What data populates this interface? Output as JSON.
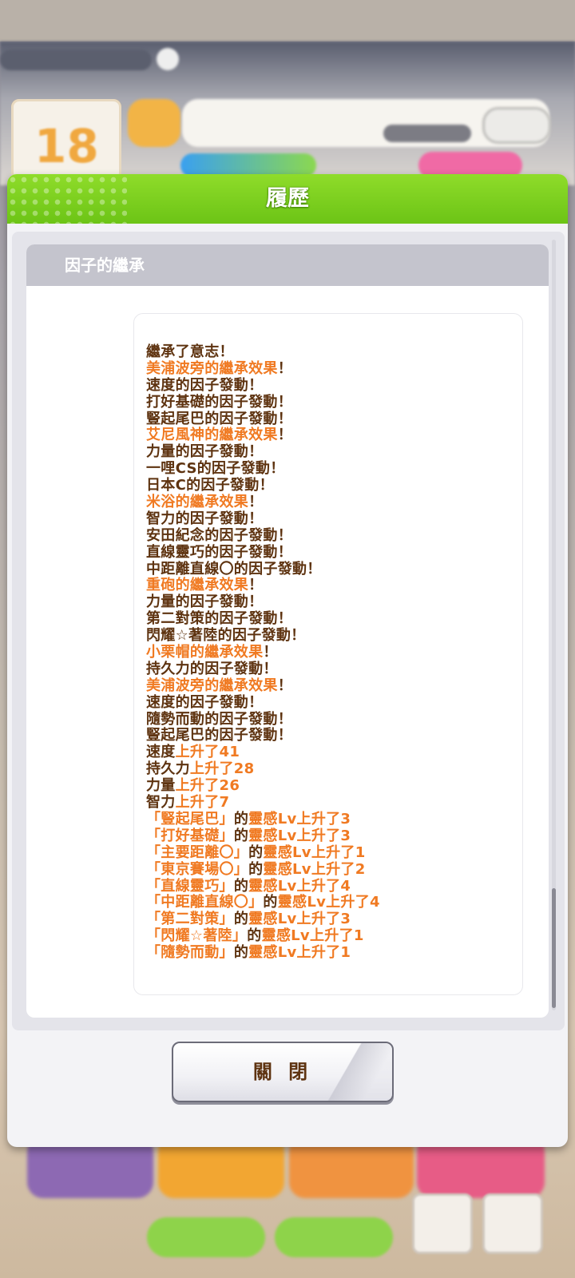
{
  "background": {
    "calendar_day": "18"
  },
  "modal": {
    "title": "履歷",
    "section_title": "因子的繼承",
    "close_label": "關 閉"
  },
  "log": [
    {
      "parts": [
        {
          "t": "繼承了意志！",
          "c": "b"
        }
      ]
    },
    {
      "parts": [
        {
          "t": "美浦波旁的繼承效果",
          "c": "o"
        },
        {
          "t": "！",
          "c": "b"
        }
      ]
    },
    {
      "parts": [
        {
          "t": "速度的因子發動！",
          "c": "b"
        }
      ]
    },
    {
      "parts": [
        {
          "t": "打好基礎的因子發動！",
          "c": "b"
        }
      ]
    },
    {
      "parts": [
        {
          "t": "豎起尾巴的因子發動！",
          "c": "b"
        }
      ]
    },
    {
      "parts": [
        {
          "t": "艾尼風神的繼承效果",
          "c": "o"
        },
        {
          "t": "！",
          "c": "b"
        }
      ]
    },
    {
      "parts": [
        {
          "t": "力量的因子發動！",
          "c": "b"
        }
      ]
    },
    {
      "parts": [
        {
          "t": "一哩CS的因子發動！",
          "c": "b"
        }
      ]
    },
    {
      "parts": [
        {
          "t": "日本C的因子發動！",
          "c": "b"
        }
      ]
    },
    {
      "parts": [
        {
          "t": "米浴的繼承效果",
          "c": "o"
        },
        {
          "t": "！",
          "c": "b"
        }
      ]
    },
    {
      "parts": [
        {
          "t": "智力的因子發動！",
          "c": "b"
        }
      ]
    },
    {
      "parts": [
        {
          "t": "安田紀念的因子發動！",
          "c": "b"
        }
      ]
    },
    {
      "parts": [
        {
          "t": "直線靈巧的因子發動！",
          "c": "b"
        }
      ]
    },
    {
      "parts": [
        {
          "t": "中距離直線〇的因子發動！",
          "c": "b"
        }
      ]
    },
    {
      "parts": [
        {
          "t": "重砲的繼承效果",
          "c": "o"
        },
        {
          "t": "！",
          "c": "b"
        }
      ]
    },
    {
      "parts": [
        {
          "t": "力量的因子發動！",
          "c": "b"
        }
      ]
    },
    {
      "parts": [
        {
          "t": "第二對策的因子發動！",
          "c": "b"
        }
      ]
    },
    {
      "parts": [
        {
          "t": "閃耀☆著陸的因子發動！",
          "c": "b"
        }
      ]
    },
    {
      "parts": [
        {
          "t": "小栗帽的繼承效果",
          "c": "o"
        },
        {
          "t": "！",
          "c": "b"
        }
      ]
    },
    {
      "parts": [
        {
          "t": "持久力的因子發動！",
          "c": "b"
        }
      ]
    },
    {
      "parts": [
        {
          "t": "美浦波旁的繼承效果",
          "c": "o"
        },
        {
          "t": "！",
          "c": "b"
        }
      ]
    },
    {
      "parts": [
        {
          "t": "速度的因子發動！",
          "c": "b"
        }
      ]
    },
    {
      "parts": [
        {
          "t": "隨勢而動的因子發動！",
          "c": "b"
        }
      ]
    },
    {
      "parts": [
        {
          "t": "豎起尾巴的因子發動！",
          "c": "b"
        }
      ]
    },
    {
      "parts": [
        {
          "t": "速度",
          "c": "b"
        },
        {
          "t": "上升了41",
          "c": "o"
        }
      ]
    },
    {
      "parts": [
        {
          "t": "持久力",
          "c": "b"
        },
        {
          "t": "上升了28",
          "c": "o"
        }
      ]
    },
    {
      "parts": [
        {
          "t": "力量",
          "c": "b"
        },
        {
          "t": "上升了26",
          "c": "o"
        }
      ]
    },
    {
      "parts": [
        {
          "t": "智力",
          "c": "b"
        },
        {
          "t": "上升了7",
          "c": "o"
        }
      ]
    },
    {
      "parts": [
        {
          "t": "「豎起尾巴」",
          "c": "o"
        },
        {
          "t": "的",
          "c": "b"
        },
        {
          "t": "靈感Lv上升了3",
          "c": "o"
        }
      ]
    },
    {
      "parts": [
        {
          "t": "「打好基礎」",
          "c": "o"
        },
        {
          "t": "的",
          "c": "b"
        },
        {
          "t": "靈感Lv上升了3",
          "c": "o"
        }
      ]
    },
    {
      "parts": [
        {
          "t": "「主要距離〇」",
          "c": "o"
        },
        {
          "t": "的",
          "c": "b"
        },
        {
          "t": "靈感Lv上升了1",
          "c": "o"
        }
      ]
    },
    {
      "parts": [
        {
          "t": "「東京賽場〇」",
          "c": "o"
        },
        {
          "t": "的",
          "c": "b"
        },
        {
          "t": "靈感Lv上升了2",
          "c": "o"
        }
      ]
    },
    {
      "parts": [
        {
          "t": "「直線靈巧」",
          "c": "o"
        },
        {
          "t": "的",
          "c": "b"
        },
        {
          "t": "靈感Lv上升了4",
          "c": "o"
        }
      ]
    },
    {
      "parts": [
        {
          "t": "「中距離直線〇」",
          "c": "o"
        },
        {
          "t": "的",
          "c": "b"
        },
        {
          "t": "靈感Lv上升了4",
          "c": "o"
        }
      ]
    },
    {
      "parts": [
        {
          "t": "「第二對策」",
          "c": "o"
        },
        {
          "t": "的",
          "c": "b"
        },
        {
          "t": "靈感Lv上升了3",
          "c": "o"
        }
      ]
    },
    {
      "parts": [
        {
          "t": "「閃耀☆著陸」",
          "c": "o"
        },
        {
          "t": "的",
          "c": "b"
        },
        {
          "t": "靈感Lv上升了1",
          "c": "o"
        }
      ]
    },
    {
      "parts": [
        {
          "t": "「隨勢而動」",
          "c": "o"
        },
        {
          "t": "的",
          "c": "b"
        },
        {
          "t": "靈感Lv上升了1",
          "c": "o"
        }
      ]
    }
  ],
  "colors": {
    "header_green": "#7ccf1f",
    "text_brown": "#5e3310",
    "text_orange": "#f07a22"
  }
}
